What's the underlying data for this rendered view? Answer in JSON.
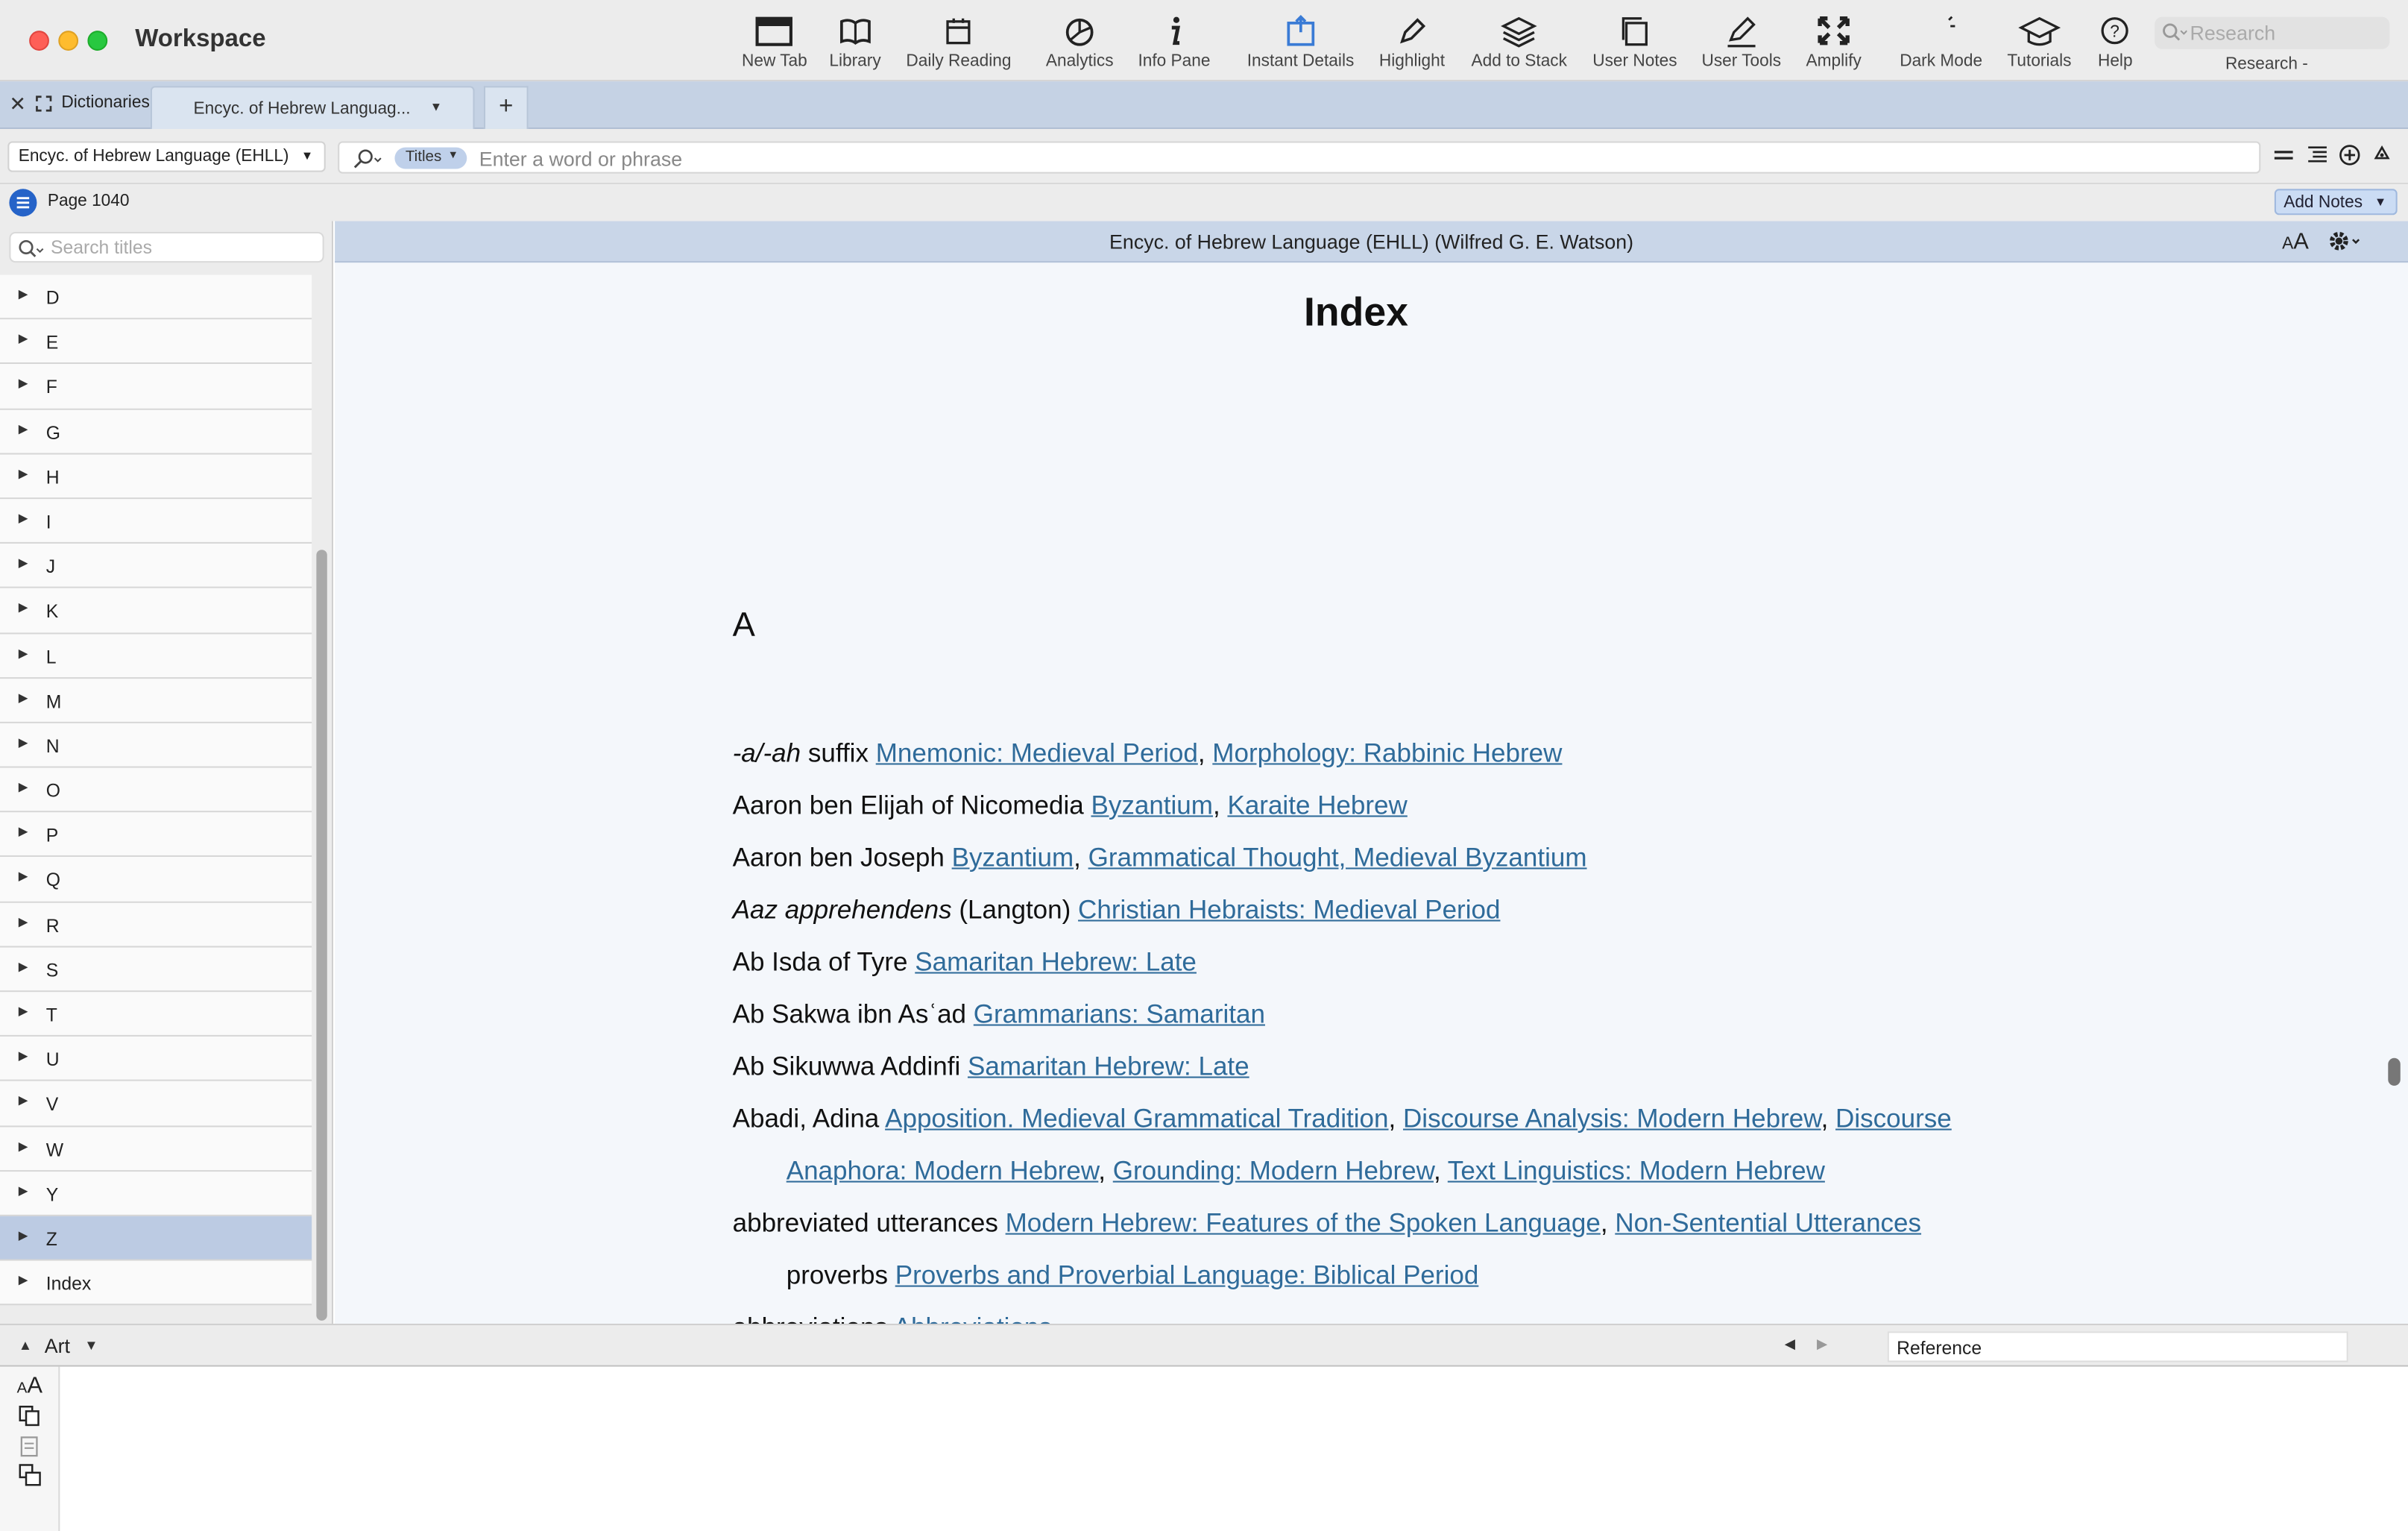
{
  "window": {
    "title": "Workspace"
  },
  "toolbar": {
    "items": [
      {
        "label": "New Tab"
      },
      {
        "label": "Library"
      },
      {
        "label": "Daily Reading"
      },
      {
        "label": "Analytics"
      },
      {
        "label": "Info Pane"
      },
      {
        "label": "Instant Details"
      },
      {
        "label": "Highlight"
      },
      {
        "label": "Add to Stack"
      },
      {
        "label": "User Notes"
      },
      {
        "label": "User Tools"
      },
      {
        "label": "Amplify"
      },
      {
        "label": "Dark Mode"
      },
      {
        "label": "Tutorials"
      },
      {
        "label": "Help"
      }
    ],
    "research_placeholder": "Research",
    "research_label": "Research -"
  },
  "tabs": {
    "panel_label": "Dictionaries",
    "active_tab": "Encyc. of Hebrew Languag...",
    "new_tab": "+"
  },
  "search": {
    "resource": "Encyc. of Hebrew Language (EHLL)",
    "scope": "Titles",
    "placeholder": "Enter a word or phrase"
  },
  "page": {
    "label": "Page 1040",
    "add_notes": "Add Notes"
  },
  "sidebar": {
    "search_placeholder": "Search titles",
    "items": [
      "D",
      "E",
      "F",
      "G",
      "H",
      "I",
      "J",
      "K",
      "L",
      "M",
      "N",
      "O",
      "P",
      "Q",
      "R",
      "S",
      "T",
      "U",
      "V",
      "W",
      "Y",
      "Z"
    ],
    "selected": "Z",
    "last_item": "Index"
  },
  "content": {
    "header": "Encyc. of Hebrew Language (EHLL) (Wilfred G. E. Watson)",
    "title": "Index",
    "letter": "A",
    "entries": [
      {
        "head_italic": "-a/-ah",
        "head": " suffix ",
        "links": [
          "Mnemonic: Medieval Period",
          "Morphology: Rabbinic Hebrew"
        ]
      },
      {
        "head": "Aaron ben Elijah of Nicomedia ",
        "links": [
          "Byzantium",
          "Karaite Hebrew"
        ]
      },
      {
        "head": "Aaron ben Joseph ",
        "links": [
          "Byzantium",
          "Grammatical Thought, Medieval Byzantium"
        ]
      },
      {
        "head_italic": "Aaz apprehendens",
        "head": " (Langton) ",
        "links": [
          "Christian Hebraists: Medieval Period"
        ]
      },
      {
        "head": "Ab Isda of Tyre ",
        "links": [
          "Samaritan Hebrew: Late"
        ]
      },
      {
        "head": "Ab Sakwa ibn Asʿad ",
        "links": [
          "Grammarians: Samaritan"
        ]
      },
      {
        "head": "Ab Sikuwwa Addinfi ",
        "links": [
          "Samaritan Hebrew: Late"
        ]
      },
      {
        "head": "Abadi, Adina ",
        "links": [
          "Apposition. Medieval Grammatical Tradition",
          "Discourse Analysis: Modern Hebrew",
          "Discourse "
        ]
      },
      {
        "sub": true,
        "head": "",
        "links": [
          "Anaphora: Modern Hebrew",
          "Grounding: Modern Hebrew",
          "Text Linguistics: Modern Hebrew"
        ]
      },
      {
        "head": "abbreviated utterances ",
        "links": [
          "Modern Hebrew: Features of the Spoken Language",
          "Non-Sentential Utterances"
        ]
      },
      {
        "sub": true,
        "head": "proverbs ",
        "links": [
          "Proverbs and Proverbial Language: Biblical Period"
        ]
      },
      {
        "head": "abbreviations ",
        "links": [
          "Abbreviations"
        ]
      }
    ]
  },
  "bottom": {
    "collection": "Art",
    "reference": "Reference"
  }
}
